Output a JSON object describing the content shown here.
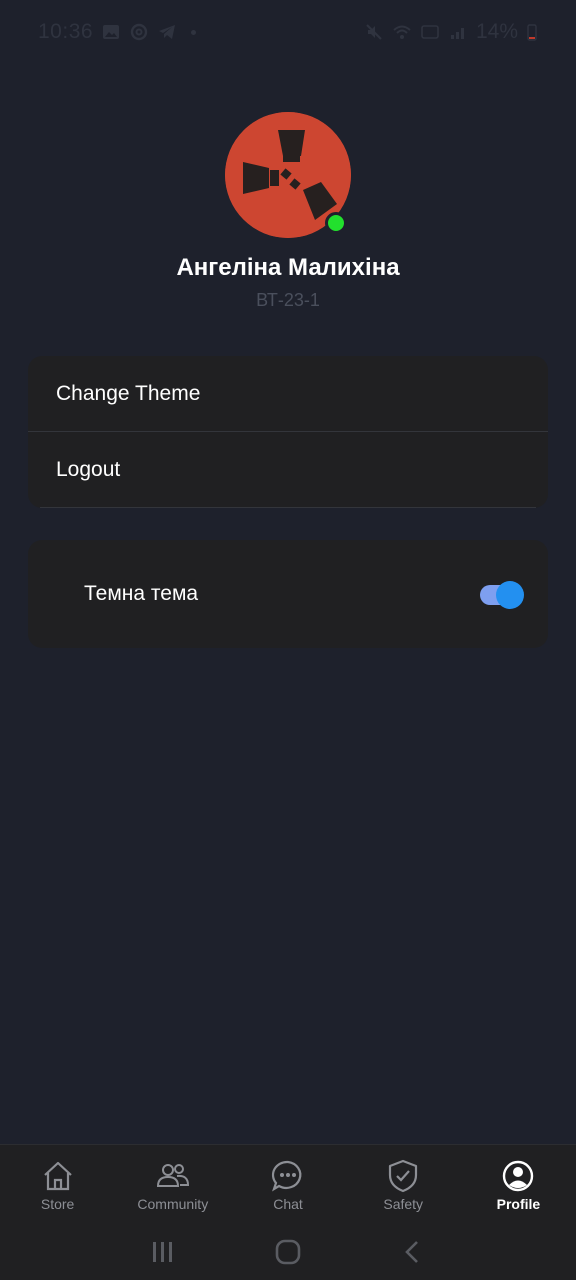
{
  "status_bar": {
    "time": "10:36",
    "battery": "14%"
  },
  "profile": {
    "name": "Ангеліна Малихіна",
    "group": "ВТ-23-1",
    "online": true,
    "avatar_color": "#cd4631"
  },
  "menu": {
    "items": [
      {
        "label": "Change Theme"
      },
      {
        "label": "Logout"
      }
    ]
  },
  "theme": {
    "label": "Темна тема",
    "icon": "moon-icon",
    "enabled": true,
    "accent_color": "#2390f0"
  },
  "bottom_nav": {
    "items": [
      {
        "label": "Store",
        "icon": "home-icon",
        "active": false
      },
      {
        "label": "Community",
        "icon": "people-icon",
        "active": false
      },
      {
        "label": "Chat",
        "icon": "chat-icon",
        "active": false
      },
      {
        "label": "Safety",
        "icon": "shield-icon",
        "active": false
      },
      {
        "label": "Profile",
        "icon": "profile-icon",
        "active": true
      }
    ]
  }
}
